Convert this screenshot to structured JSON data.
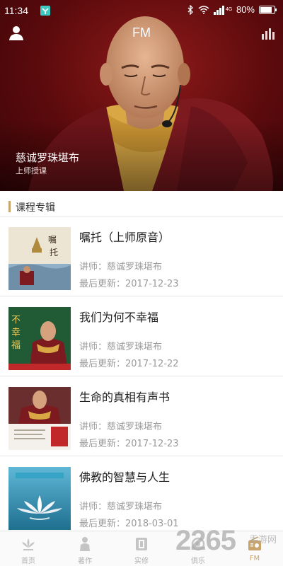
{
  "status_bar": {
    "time": "11:34",
    "network": "4G",
    "battery_text": "80%"
  },
  "header": {
    "title": "FM",
    "left_icon": "user-icon",
    "right_icon": "bar-chart-icon"
  },
  "hero": {
    "name": "慈诚罗珠堪布",
    "subtitle": "上师授课"
  },
  "section": {
    "title": "课程专辑"
  },
  "albums": [
    {
      "title": "嘱托（上师原音）",
      "lecturer": "讲师：慈诚罗珠堪布",
      "updated": "最后更新：2017-12-23",
      "cover_text": "嘱托"
    },
    {
      "title": "我们为何不幸福",
      "lecturer": "讲师：慈诚罗珠堪布",
      "updated": "最后更新：2017-12-22",
      "cover_text": "不幸福"
    },
    {
      "title": "生命的真相有声书",
      "lecturer": "讲师：慈诚罗珠堪布",
      "updated": "最后更新：2017-12-23",
      "cover_text": ""
    },
    {
      "title": "佛教的智慧与人生",
      "lecturer": "讲师：慈诚罗珠堪布",
      "updated": "最后更新：2018-03-01",
      "cover_text": ""
    }
  ],
  "bottom_nav": {
    "items": [
      {
        "label": "首页",
        "icon": "lotus-icon"
      },
      {
        "label": "著作",
        "icon": "figure-icon"
      },
      {
        "label": "实修",
        "icon": "book-icon"
      },
      {
        "label": "俱乐",
        "icon": "club-icon"
      },
      {
        "label": "FM",
        "icon": "radio-icon"
      }
    ],
    "active_index": 4
  },
  "watermark": {
    "big": "2265",
    "small": "手游网"
  },
  "colors": {
    "accent": "#c8a46a",
    "hero_red": "#7a1216",
    "robe_maroon": "#7d1a1f",
    "robe_yellow": "#d9a845"
  }
}
